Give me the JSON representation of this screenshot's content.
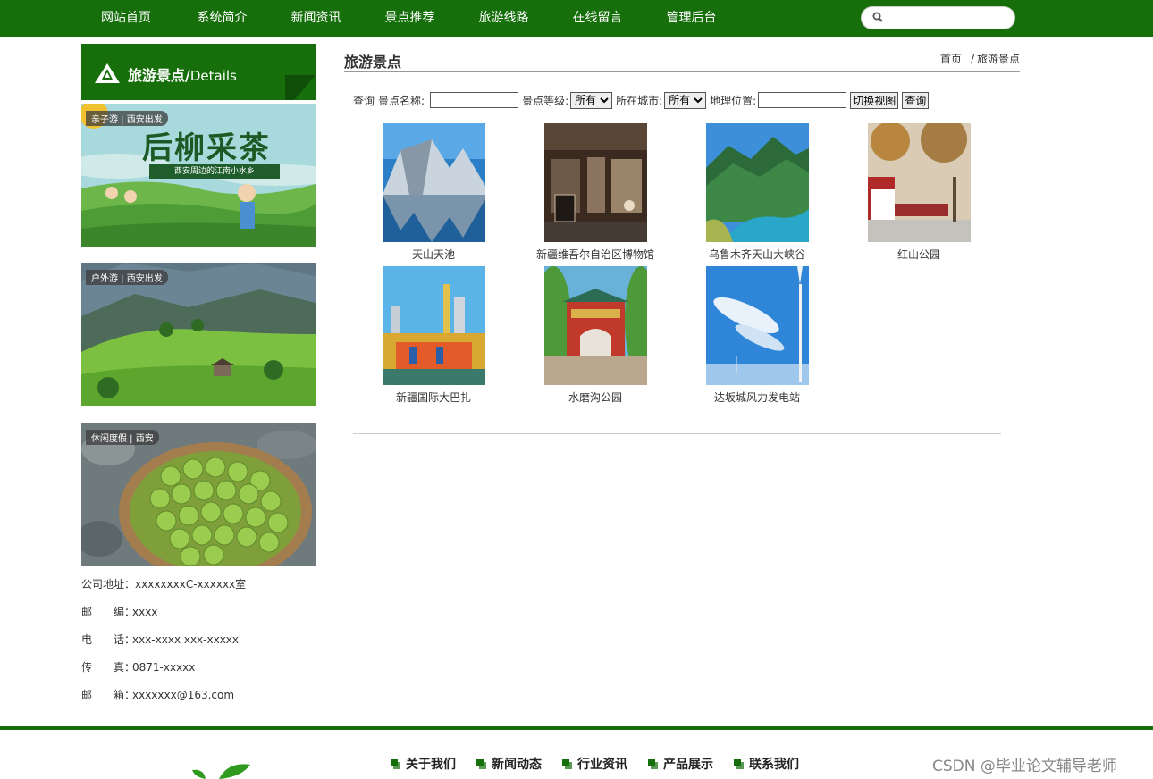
{
  "nav": {
    "items": [
      "网站首页",
      "系统简介",
      "新闻资讯",
      "景点推荐",
      "旅游线路",
      "在线留言",
      "管理后台"
    ],
    "search_placeholder": ""
  },
  "sidebar": {
    "title_cn": "旅游景点/",
    "title_en": "Details",
    "promos": [
      {
        "tag": "亲子游 | 西安出发",
        "title": "后柳采茶",
        "subtitle": "西安周边的江南小水乡"
      },
      {
        "tag": "户外游 | 西安出发"
      },
      {
        "tag": "休闲度假 | 西安"
      }
    ],
    "contact": [
      {
        "key": "公司地址：",
        "value": "xxxxxxxxC-xxxxxx室"
      },
      {
        "key": "邮　　编：",
        "value": "xxxx"
      },
      {
        "key": "电　　话：",
        "value": "xxx-xxxx xxx-xxxxx"
      },
      {
        "key": "传　　真：",
        "value": "0871-xxxxx"
      },
      {
        "key": "邮　　箱：",
        "value": "xxxxxxx@163.com"
      }
    ]
  },
  "main": {
    "title": "旅游景点",
    "breadcrumb": {
      "home": "首页",
      "sep": "/",
      "current": "旅游景点"
    },
    "query": {
      "label": "查询",
      "name_label": "景点名称:",
      "level_label": "景点等级:",
      "level_value": "所有",
      "city_label": "所在城市:",
      "city_value": "所有",
      "geo_label": "地理位置:",
      "switch_btn": "切换视图",
      "query_btn": "查询"
    },
    "scenes": [
      {
        "name": "天山天池",
        "img": "mountain-lake"
      },
      {
        "name": "新疆维吾尔自治区博物馆",
        "img": "museum"
      },
      {
        "name": "乌鲁木齐天山大峡谷",
        "img": "canyon"
      },
      {
        "name": "红山公园",
        "img": "park"
      },
      {
        "name": "新疆国际大巴扎",
        "img": "bazaar"
      },
      {
        "name": "水磨沟公园",
        "img": "gate"
      },
      {
        "name": "达坂城风力发电站",
        "img": "wind-turbine"
      }
    ]
  },
  "footer": {
    "links": [
      "关于我们",
      "新闻动态",
      "行业资讯",
      "产品展示",
      "联系我们"
    ],
    "watermark": "CSDN @毕业论文辅导老师"
  },
  "colors": {
    "brand": "#166f0b",
    "text": "#333333"
  }
}
